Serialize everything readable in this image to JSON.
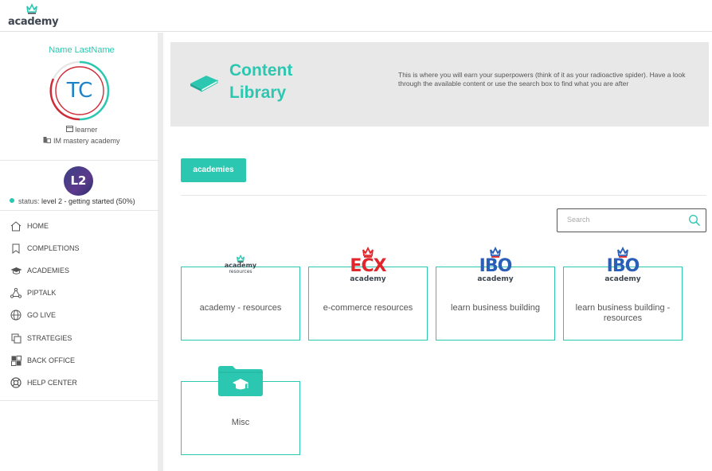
{
  "app": {
    "logo_text": "academy"
  },
  "profile": {
    "name": "Name LastName",
    "initials": "TC",
    "role": "learner",
    "organization": "IM mastery academy",
    "level_badge": "L2",
    "status_prefix": "status:",
    "status_value": "level 2 - getting started (50%)",
    "level_progress_percent": 50
  },
  "nav": {
    "items": [
      {
        "label": "HOME",
        "icon": "home-icon"
      },
      {
        "label": "COMPLETIONS",
        "icon": "bookmark-icon"
      },
      {
        "label": "ACADEMIES",
        "icon": "graduation-cap-icon"
      },
      {
        "label": "PIPTALK",
        "icon": "network-icon"
      },
      {
        "label": "GO LIVE",
        "icon": "globe-icon"
      },
      {
        "label": "STRATEGIES",
        "icon": "copy-icon"
      },
      {
        "label": "BACK OFFICE",
        "icon": "grid-icon"
      },
      {
        "label": "HELP CENTER",
        "icon": "lifebuoy-icon"
      }
    ]
  },
  "hero": {
    "title": "Content Library",
    "description": "This is where you will earn your superpowers (think of it as your radioactive spider). Have a look through the available content or use the search box to find what you are after"
  },
  "filters": {
    "academies_label": "academies"
  },
  "search": {
    "placeholder": "Search"
  },
  "cards": [
    {
      "label": "academy - resources",
      "logo": {
        "main": "academy",
        "sub": "resources"
      }
    },
    {
      "label": "e-commerce resources",
      "logo": {
        "main": "ECX",
        "sub": "academy"
      }
    },
    {
      "label": "learn business building",
      "logo": {
        "main": "IBO",
        "sub": "academy"
      }
    },
    {
      "label": "learn business building - resources",
      "logo": {
        "main": "IBO",
        "sub": "academy"
      }
    },
    {
      "label": "Misc",
      "icon": "folder-graduation-icon"
    }
  ],
  "colors": {
    "accent": "#2cc7b0",
    "ecx_red": "#e0262b",
    "ibo_blue": "#2a5fb8",
    "hero_bg": "#e8e8e8"
  }
}
